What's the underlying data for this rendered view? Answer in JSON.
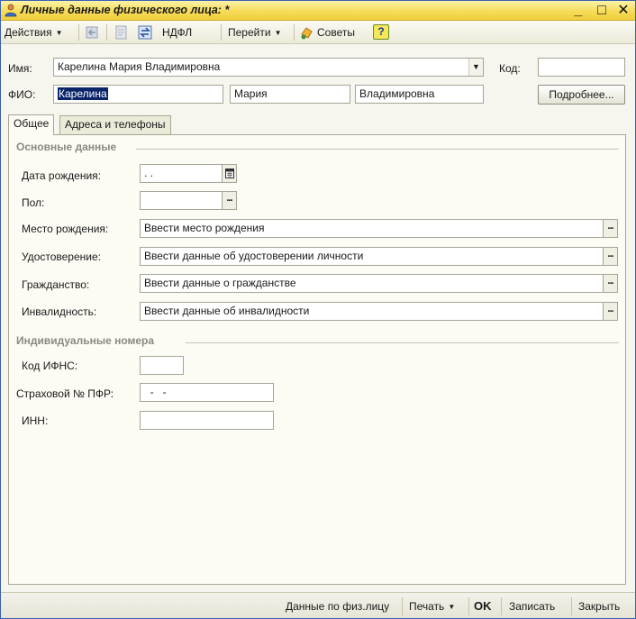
{
  "window": {
    "title": "Личные данные физического лица: *",
    "minimize_glyph": "_",
    "maximize_glyph": "□",
    "close_glyph": "✕"
  },
  "toolbar": {
    "actions_label": "Действия",
    "ndfl_label": "НДФЛ",
    "goto_label": "Перейти",
    "tips_label": "Советы",
    "help_glyph": "?"
  },
  "header": {
    "name_label": "Имя:",
    "name_value": "Карелина Мария Владимировна",
    "code_label": "Код:",
    "code_value": "",
    "fio_label": "ФИО:",
    "surname_value": "Карелина",
    "firstname_value": "Мария",
    "patronymic_value": "Владимировна",
    "details_button": "Подробнее..."
  },
  "tabs": [
    {
      "label": "Общее",
      "active": true
    },
    {
      "label": "Адреса и телефоны",
      "active": false
    }
  ],
  "main_section": {
    "title": "Основные данные",
    "birth_date_label": "Дата рождения:",
    "birth_date_value": " .  .",
    "gender_label": "Пол:",
    "gender_value": "",
    "birthplace_label": "Место рождения:",
    "birthplace_value": "Ввести место рождения",
    "id_doc_label": "Удостоверение:",
    "id_doc_value": "Ввести данные об удостоверении личности",
    "citizenship_label": "Гражданство:",
    "citizenship_value": "Ввести данные о гражданстве",
    "disability_label": "Инвалидность:",
    "disability_value": "Ввести данные об инвалидности"
  },
  "numbers_section": {
    "title": "Индивидуальные номера",
    "ifns_label": "Код ИФНС:",
    "ifns_value": "",
    "pfr_label": "Страховой № ПФР:",
    "pfr_value": "  -   -",
    "inn_label": "ИНН:",
    "inn_value": ""
  },
  "bottom": {
    "person_data_label": "Данные по физ.лицу",
    "print_label": "Печать",
    "ok_label": "OK",
    "save_label": "Записать",
    "close_label": "Закрыть"
  },
  "colors": {
    "titlebar": "#f6dc5a",
    "selection": "#0a246a",
    "section_title": "#8a8a80"
  }
}
